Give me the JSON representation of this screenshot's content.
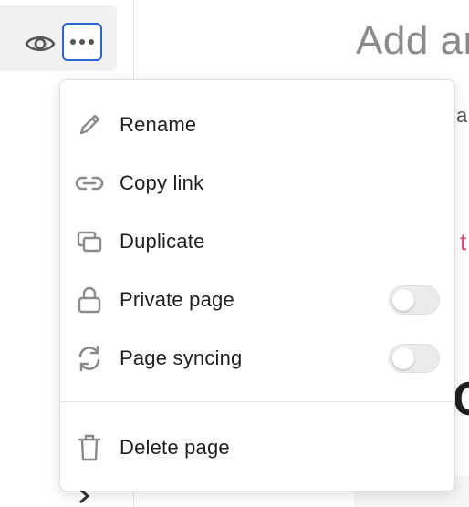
{
  "menu": {
    "items": [
      {
        "id": "rename",
        "label": "Rename",
        "icon": "pencil-icon"
      },
      {
        "id": "copy-link",
        "label": "Copy link",
        "icon": "link-icon"
      },
      {
        "id": "duplicate",
        "label": "Duplicate",
        "icon": "duplicate-icon"
      },
      {
        "id": "private-page",
        "label": "Private page",
        "icon": "lock-icon",
        "toggle": false
      },
      {
        "id": "page-syncing",
        "label": "Page syncing",
        "icon": "sync-icon",
        "toggle": false
      }
    ],
    "delete": {
      "label": "Delete page",
      "icon": "trash-icon"
    }
  },
  "background": {
    "heading_peek": "Add ar",
    "peek_text": "a",
    "peek_pink": "t",
    "peek_big": "C"
  },
  "colors": {
    "focus_ring": "#2e64d1",
    "icon_gray": "#8a8a8a",
    "pink_accent": "#d6497a",
    "toggle_off": "#ebebeb"
  }
}
